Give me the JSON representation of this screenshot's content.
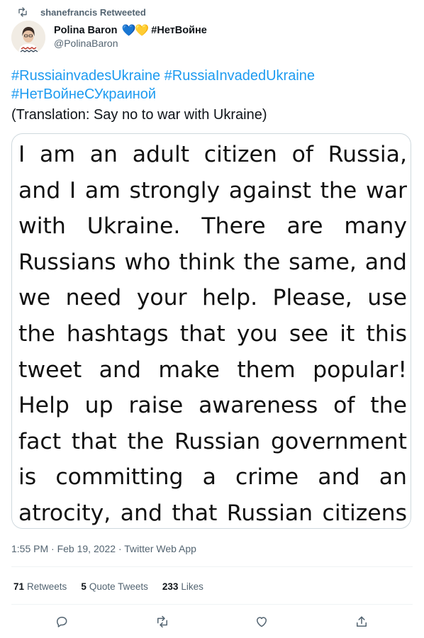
{
  "retweet_banner": {
    "text": "shanefrancis Retweeted"
  },
  "author": {
    "name": "Polina Baron",
    "hearts": [
      "💙",
      "💛"
    ],
    "name_tag": "#НетВойне",
    "handle": "@PolinaBaron"
  },
  "tweet": {
    "hashtags_line1": "#RussiainvadesUkraine #RussiaInvadedUkraine",
    "hashtags_line2": "#НетВойнеСУкраиной",
    "translation": "(Translation: Say no to war with Ukraine)",
    "image_text": "I am an adult citizen of Russia, and I am strongly against the war with Ukraine. There are many Russians who think the same, and we need your help. Please, use the hashtags that you see it this tweet and make them popular! Help up raise awareness of the fact that the Russian government is committing a crime and an atrocity, and that Russian citizens do not support it.",
    "timestamp": "1:55 PM · Feb 19, 2022 · Twitter Web App"
  },
  "stats": {
    "retweets_count": "71",
    "retweets_label": "Retweets",
    "quotes_count": "5",
    "quotes_label": "Quote Tweets",
    "likes_count": "233",
    "likes_label": "Likes"
  },
  "actions": [
    "reply-icon",
    "retweet-icon",
    "like-icon",
    "share-icon"
  ],
  "colors": {
    "link": "#1d9bf0",
    "secondary_text": "#536471",
    "primary_text": "#0f1419",
    "border": "#cfd9de"
  }
}
